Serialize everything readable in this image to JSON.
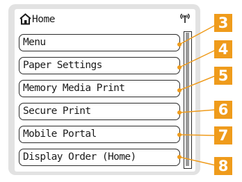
{
  "screen": {
    "title": "Home",
    "home_icon": "home-icon",
    "signal_icon": "wireless-signal-icon"
  },
  "menu_items": [
    {
      "label": "Menu",
      "callout": "3"
    },
    {
      "label": "Paper Settings",
      "callout": "4"
    },
    {
      "label": "Memory Media Print",
      "callout": "5"
    },
    {
      "label": "Secure Print",
      "callout": "6"
    },
    {
      "label": "Mobile Portal",
      "callout": "7"
    },
    {
      "label": "Display Order (Home)",
      "callout": "8"
    }
  ],
  "colors": {
    "callout_badge": "#ef9b1b",
    "panel_frame": "#e2e2e2",
    "scroll_thumb": "#9a9a9a"
  }
}
